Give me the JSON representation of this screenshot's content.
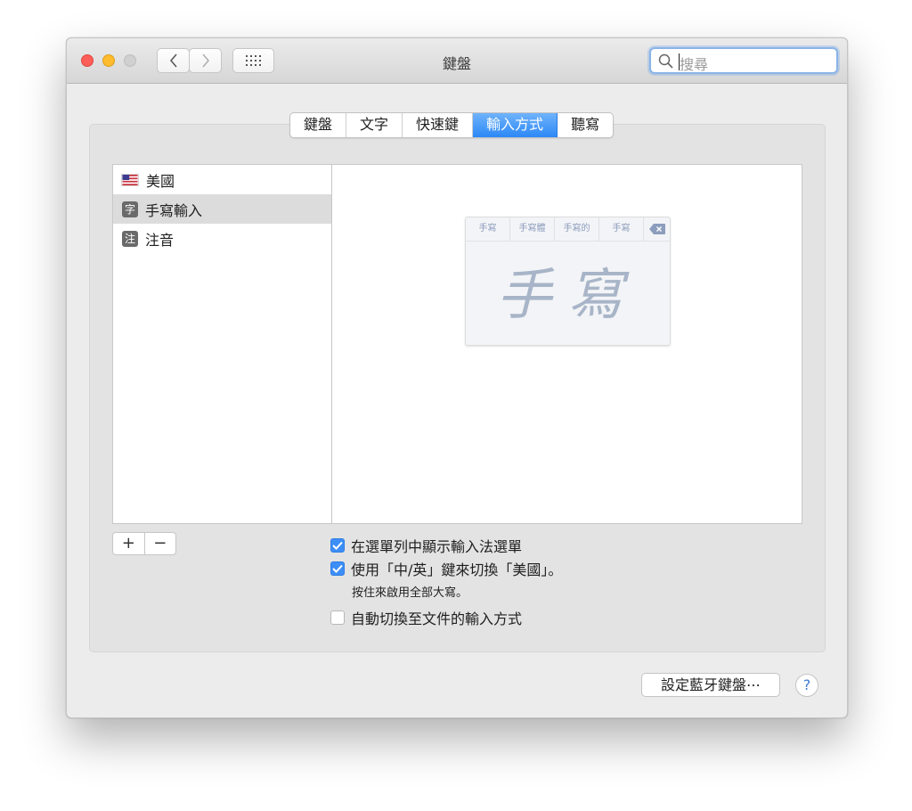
{
  "window": {
    "title": "鍵盤"
  },
  "toolbar": {
    "grid_icon": "grid-icon",
    "back_icon": "chevron-left-icon",
    "forward_icon": "chevron-right-icon"
  },
  "search": {
    "placeholder": "搜尋",
    "icon": "search-icon"
  },
  "tabs": [
    {
      "label": "鍵盤",
      "active": false
    },
    {
      "label": "文字",
      "active": false
    },
    {
      "label": "快速鍵",
      "active": false
    },
    {
      "label": "輸入方式",
      "active": true
    },
    {
      "label": "聽寫",
      "active": false
    }
  ],
  "sources": [
    {
      "label": "美國",
      "icon": "us-flag-icon",
      "selected": false
    },
    {
      "label": "手寫輸入",
      "badge": "字",
      "icon": "handwriting-icon",
      "selected": true
    },
    {
      "label": "注音",
      "badge": "注",
      "icon": "zhuyin-icon",
      "selected": false
    }
  ],
  "preview": {
    "candidates": [
      "手寫",
      "手寫體",
      "手寫的",
      "手寫"
    ],
    "handwriting": "手寫",
    "delete_icon": "delete-backward-icon"
  },
  "list_controls": {
    "add": "+",
    "remove": "−"
  },
  "options": {
    "show_menu": {
      "label": "在選單列中顯示輸入法選單",
      "checked": true
    },
    "caps_switch": {
      "label": "使用「中/英」鍵來切換「美國」。",
      "checked": true
    },
    "caps_note": "按住來啟用全部大寫。",
    "auto_switch": {
      "label": "自動切換至文件的輸入方式",
      "checked": false
    }
  },
  "buttons": {
    "bluetooth": "設定藍牙鍵盤⋯",
    "help": "?"
  },
  "colors": {
    "accent": "#3d8ef7",
    "close": "#fc5f57",
    "minimize": "#fdbc2e"
  }
}
